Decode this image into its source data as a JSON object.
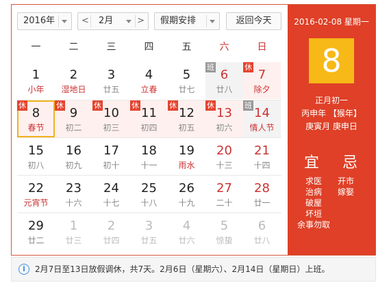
{
  "toolbar": {
    "year": "2016年",
    "month": "2月",
    "prev_glyph": "<",
    "next_glyph": ">",
    "holiday": "假期安排",
    "today": "返回今天"
  },
  "weekdays": [
    "一",
    "二",
    "三",
    "四",
    "五",
    "六",
    "日"
  ],
  "weeks": [
    [
      {
        "d": "1",
        "l": "小年",
        "fest": true
      },
      {
        "d": "2",
        "l": "湿地日",
        "fest": true
      },
      {
        "d": "3",
        "l": "廿五"
      },
      {
        "d": "4",
        "l": "立春",
        "fest": true
      },
      {
        "d": "5",
        "l": "廿七"
      },
      {
        "d": "6",
        "l": "廿八",
        "tag": "班",
        "red": true
      },
      {
        "d": "7",
        "l": "除夕",
        "tag": "休",
        "red": true,
        "fest": true
      }
    ],
    [
      {
        "d": "8",
        "l": "春节",
        "tag": "休",
        "selected": true,
        "fest": true
      },
      {
        "d": "9",
        "l": "初二",
        "tag": "休"
      },
      {
        "d": "10",
        "l": "初三",
        "tag": "休"
      },
      {
        "d": "11",
        "l": "初四",
        "tag": "休"
      },
      {
        "d": "12",
        "l": "初五",
        "tag": "休"
      },
      {
        "d": "13",
        "l": "初六",
        "tag": "休",
        "red": true
      },
      {
        "d": "14",
        "l": "情人节",
        "tag": "班",
        "red": true,
        "fest": true
      }
    ],
    [
      {
        "d": "15",
        "l": "初八"
      },
      {
        "d": "16",
        "l": "初九"
      },
      {
        "d": "17",
        "l": "初十"
      },
      {
        "d": "18",
        "l": "十一"
      },
      {
        "d": "19",
        "l": "雨水",
        "fest": true
      },
      {
        "d": "20",
        "l": "十三",
        "red": true
      },
      {
        "d": "21",
        "l": "十四",
        "red": true
      }
    ],
    [
      {
        "d": "22",
        "l": "元宵节",
        "fest": true
      },
      {
        "d": "23",
        "l": "十六"
      },
      {
        "d": "24",
        "l": "十七"
      },
      {
        "d": "25",
        "l": "十八"
      },
      {
        "d": "26",
        "l": "十九"
      },
      {
        "d": "27",
        "l": "二十",
        "red": true
      },
      {
        "d": "28",
        "l": "廿一",
        "red": true
      }
    ],
    [
      {
        "d": "29",
        "l": "廿二"
      },
      {
        "d": "1",
        "l": "廿三",
        "other": true
      },
      {
        "d": "2",
        "l": "廿四",
        "other": true
      },
      {
        "d": "3",
        "l": "廿五",
        "other": true
      },
      {
        "d": "4",
        "l": "廿六",
        "other": true
      },
      {
        "d": "5",
        "l": "惊蛰",
        "other": true
      },
      {
        "d": "6",
        "l": "廿八",
        "other": true
      }
    ]
  ],
  "side": {
    "date": "2016-02-08 星期一",
    "big_day": "8",
    "lunar_line1": "正月初一",
    "lunar_line2": "丙申年 【猴年】",
    "lunar_line3": "庚寅月 庚申日",
    "yi_title": "宜",
    "ji_title": "忌",
    "yi": [
      "求医",
      "治病",
      "破屋",
      "坏垣",
      "余事勿取"
    ],
    "ji": [
      "开市",
      "嫁娶"
    ]
  },
  "note": {
    "icon": "i",
    "text": "2月7日至13日放假调休，共7天。2月6日（星期六）、2月14日（星期日）上班。"
  },
  "colors": {
    "accent": "#df4027",
    "selected_border": "#f0b21e",
    "holiday_tag": "#e5432e",
    "work_tag": "#999999"
  }
}
